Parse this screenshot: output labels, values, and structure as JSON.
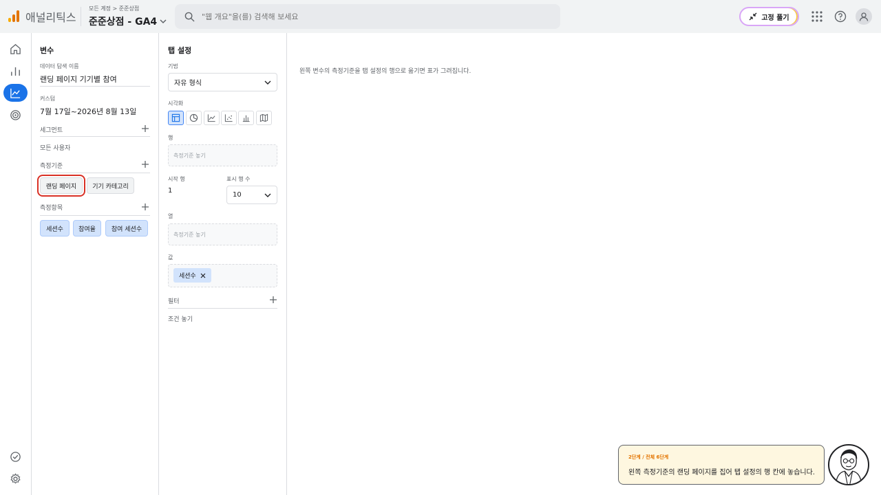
{
  "header": {
    "brand": "애널리틱스",
    "breadcrumb": "모든 계정 > 준준상점",
    "property": "준준상점 - GA4",
    "search_placeholder": "\"웹 개요\"을(를) 검색해 보세요",
    "unpin_label": "고정 풀기",
    "logo_colors": [
      "#f9ab00",
      "#e37400",
      "#e37400"
    ]
  },
  "variables": {
    "title": "변수",
    "exploration_name_label": "데이터 탐색 이름",
    "exploration_name": "랜딩 페이지 기기별 참여",
    "custom_label": "커스텀",
    "date_range": "7월 17일~2026년 8월 13일",
    "segments_label": "세그먼트",
    "all_users": "모든 사용자",
    "dimensions_label": "측정기준",
    "dimensions": [
      "랜딩 페이지",
      "기기 카테고리"
    ],
    "metrics_label": "측정항목",
    "metrics": [
      "세션수",
      "참여율",
      "참여 세션수"
    ]
  },
  "tab_settings": {
    "title": "탭 설정",
    "technique_label": "기법",
    "technique_value": "자유 형식",
    "visualization_label": "시각화",
    "rows_label": "행",
    "rows_placeholder": "측정기준 놓기",
    "start_row_label": "시작 행",
    "start_row_value": "1",
    "show_rows_label": "표시 행 수",
    "show_rows_value": "10",
    "columns_label": "열",
    "columns_placeholder": "측정기준 놓기",
    "values_label": "값",
    "value_chip": "세션수",
    "filters_label": "필터",
    "filters_placeholder": "조건 놓기"
  },
  "canvas": {
    "hint": "왼쪽 변수의 측정기준을 탭 설정의 행으로 옮기면 표가 그려집니다."
  },
  "tutorial": {
    "step": "2단계 / 전체 6단계",
    "text": "왼쪽 측정기준의 랜딩 페이지를 집어 탭 설정의 행 칸에 놓습니다."
  }
}
